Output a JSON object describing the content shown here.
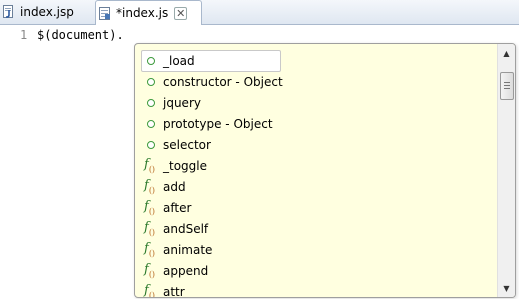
{
  "tabs": [
    {
      "label": "index.jsp",
      "icon": "jsp-file-icon",
      "active": false
    },
    {
      "label": "*index.js",
      "icon": "js-file-icon",
      "active": true,
      "close_glyph": "✕"
    }
  ],
  "editor": {
    "lines": [
      {
        "number": "1",
        "text": "$(document)."
      }
    ]
  },
  "autocomplete": {
    "items": [
      {
        "label": "_load",
        "kind": "property",
        "selected": true
      },
      {
        "label": "constructor - Object",
        "kind": "property"
      },
      {
        "label": "jquery",
        "kind": "property"
      },
      {
        "label": "prototype - Object",
        "kind": "property"
      },
      {
        "label": "selector",
        "kind": "property"
      },
      {
        "label": "_toggle",
        "kind": "function"
      },
      {
        "label": "add",
        "kind": "function"
      },
      {
        "label": "after",
        "kind": "function"
      },
      {
        "label": "andSelf",
        "kind": "function"
      },
      {
        "label": "animate",
        "kind": "function"
      },
      {
        "label": "append",
        "kind": "function"
      },
      {
        "label": "attr",
        "kind": "function"
      }
    ],
    "scrollbar": {
      "up_glyph": "▲",
      "down_glyph": "▼"
    }
  },
  "colors": {
    "popup_bg": "#ffffe0",
    "property_icon": "#3d9a3d",
    "function_icon": "#2c7a2c"
  }
}
